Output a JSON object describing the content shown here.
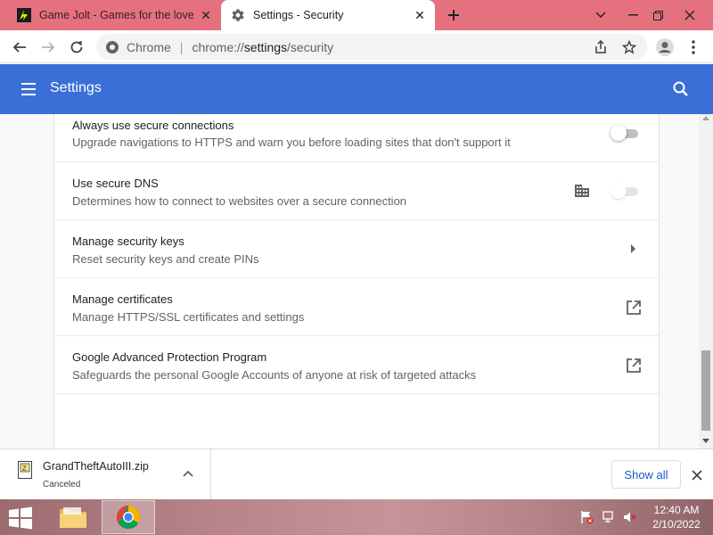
{
  "tabs": [
    {
      "title": "Game Jolt - Games for the love o",
      "favicon": "gamejolt-icon",
      "active": false
    },
    {
      "title": "Settings - Security",
      "favicon": "gear-icon",
      "active": true
    }
  ],
  "toolbar": {
    "omnibox_label": "Chrome",
    "url_scheme": "chrome://",
    "url_path": "settings",
    "url_rest": "/security"
  },
  "settings_header": {
    "title": "Settings"
  },
  "rows": [
    {
      "primary": "Always use secure connections",
      "secondary": "Upgrade navigations to HTTPS and warn you before loading sites that don't support it",
      "control": "toggle",
      "enabled": false
    },
    {
      "primary": "Use secure DNS",
      "secondary": "Determines how to connect to websites over a secure connection",
      "control": "toggle-disabled",
      "managed_icon": "building-icon"
    },
    {
      "primary": "Manage security keys",
      "secondary": "Reset security keys and create PINs",
      "control": "arrow-right"
    },
    {
      "primary": "Manage certificates",
      "secondary": "Manage HTTPS/SSL certificates and settings",
      "control": "open-in-new"
    },
    {
      "primary": "Google Advanced Protection Program",
      "secondary": "Safeguards the personal Google Accounts of anyone at risk of targeted attacks",
      "control": "open-in-new"
    }
  ],
  "download_shelf": {
    "file_name": "GrandTheftAutoIII.zip",
    "status": "Canceled",
    "show_all_label": "Show all"
  },
  "taskbar": {
    "time": "12:40 AM",
    "date": "2/10/2022"
  },
  "colors": {
    "tab_strip": "#e5717f",
    "settings_header": "#3b6fd8",
    "link_blue": "#1a56c6"
  }
}
